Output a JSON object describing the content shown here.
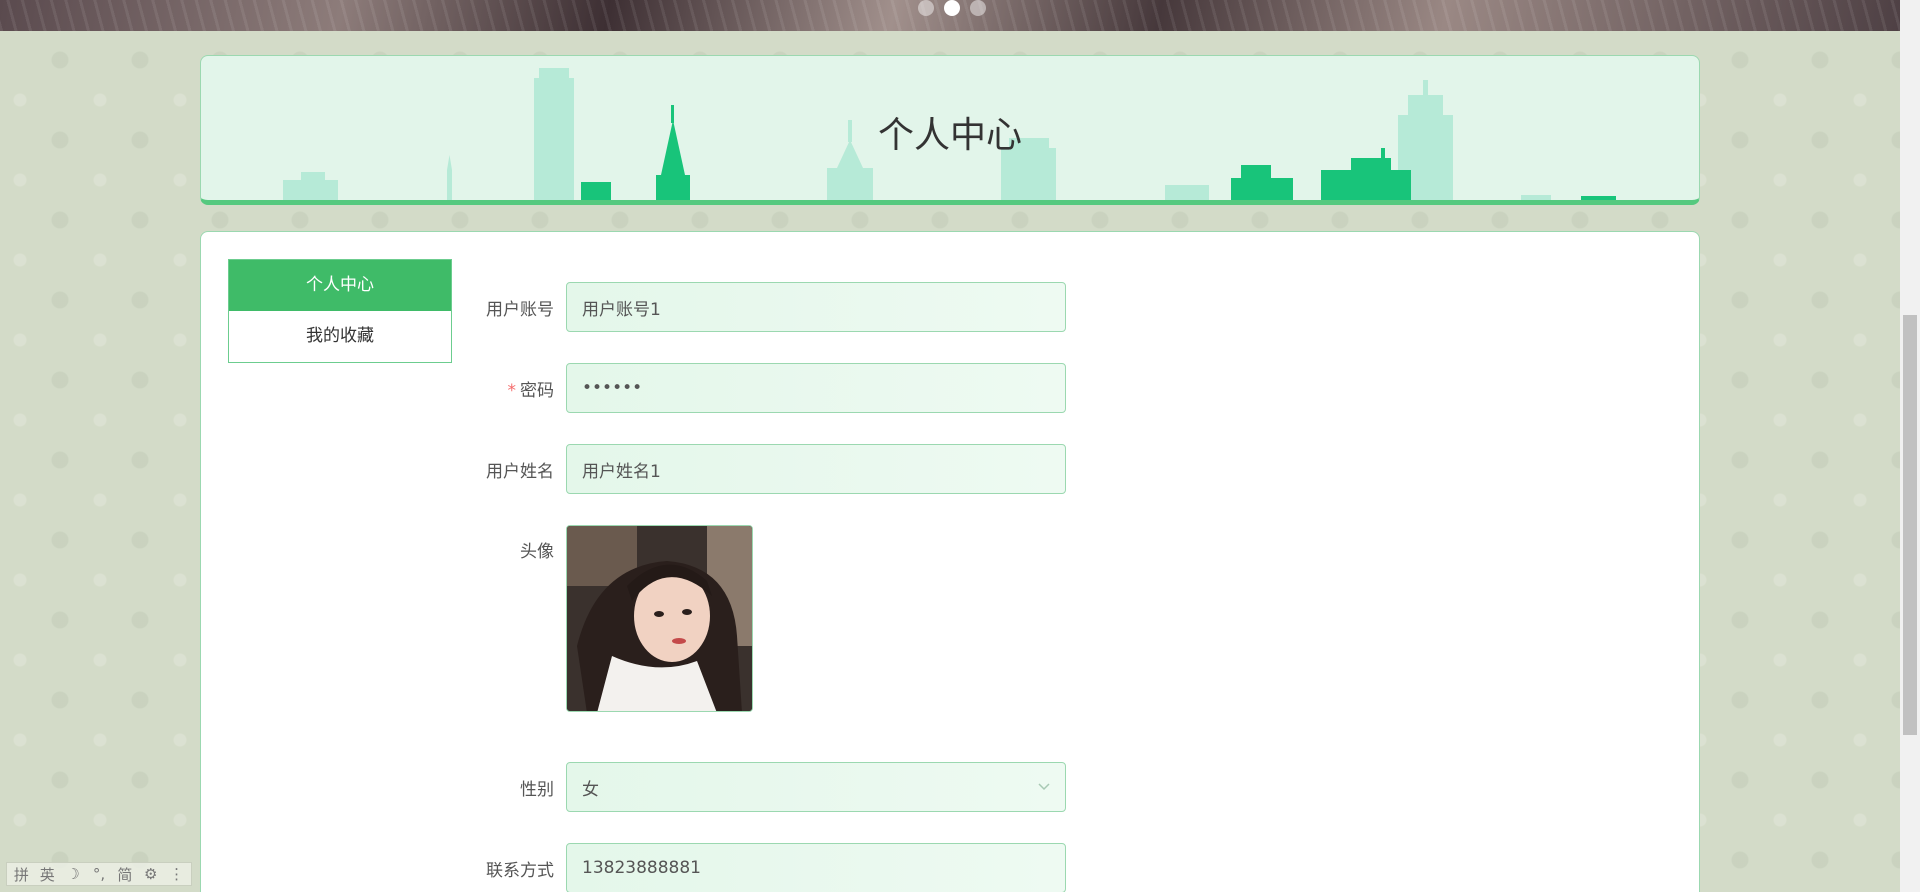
{
  "banner": {
    "dots": [
      {
        "active": false
      },
      {
        "active": true
      },
      {
        "active": false
      }
    ]
  },
  "header": {
    "title": "个人中心"
  },
  "sidebar": {
    "items": [
      {
        "label": "个人中心",
        "active": true
      },
      {
        "label": "我的收藏",
        "active": false
      }
    ]
  },
  "form": {
    "username": {
      "label": "用户账号",
      "value": "用户账号1"
    },
    "password": {
      "label": "密码",
      "required_mark": "*",
      "value": "••••••"
    },
    "realname": {
      "label": "用户姓名",
      "value": "用户姓名1"
    },
    "avatar": {
      "label": "头像"
    },
    "gender": {
      "label": "性别",
      "value": "女"
    },
    "phone": {
      "label": "联系方式",
      "value": "13823888881"
    }
  },
  "ime": {
    "glyphs": [
      "拼",
      "英",
      "☽",
      "°,",
      "简",
      "⚙",
      "⋮"
    ]
  },
  "colors": {
    "accent": "#3fbb68",
    "header_bg": "#e2f5ea",
    "border": "#9bd8b0",
    "input_bg": "#e4f7ea",
    "required": "#f56c6c"
  }
}
